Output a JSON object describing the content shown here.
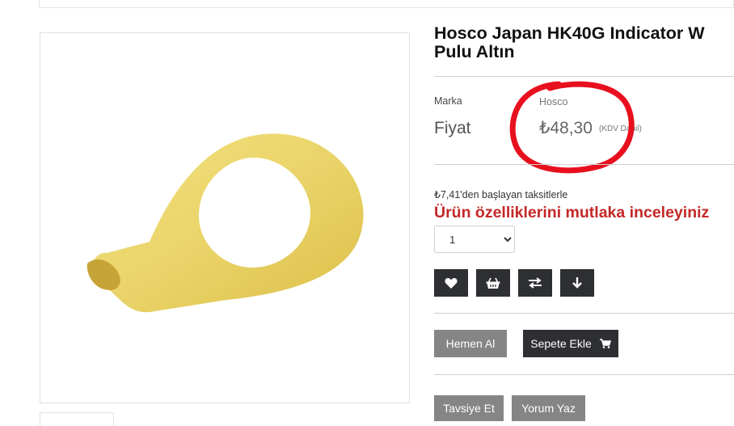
{
  "product": {
    "title_line1": "Hosco Japan HK40G Indicator W",
    "title_line2": "Pulu Altın",
    "brand_label": "Marka",
    "brand_value": "Hosco",
    "price_label": "Fiyat",
    "price_value": "₺48,30",
    "price_note": "(KDV Dahil)",
    "installment_text": "₺7,41'den başlayan taksitlerle",
    "warning_text": "Ürün özelliklerini mutlaka inceleyiniz"
  },
  "quantity": {
    "selected": "1",
    "options": [
      "1"
    ]
  },
  "actions": {
    "icons": [
      "heart-icon",
      "basket-icon",
      "compare-icon",
      "download-icon"
    ],
    "buy_now": "Hemen Al",
    "add_to_cart": "Sepete Ekle",
    "recommend": "Tavsiye Et",
    "write_review": "Yorum Yaz"
  },
  "colors": {
    "accent_red": "#c42828",
    "dark_button": "#2e2f33",
    "grey_button": "#858585",
    "annotation_red": "#e8101e",
    "product_gold": "#ecd766"
  }
}
